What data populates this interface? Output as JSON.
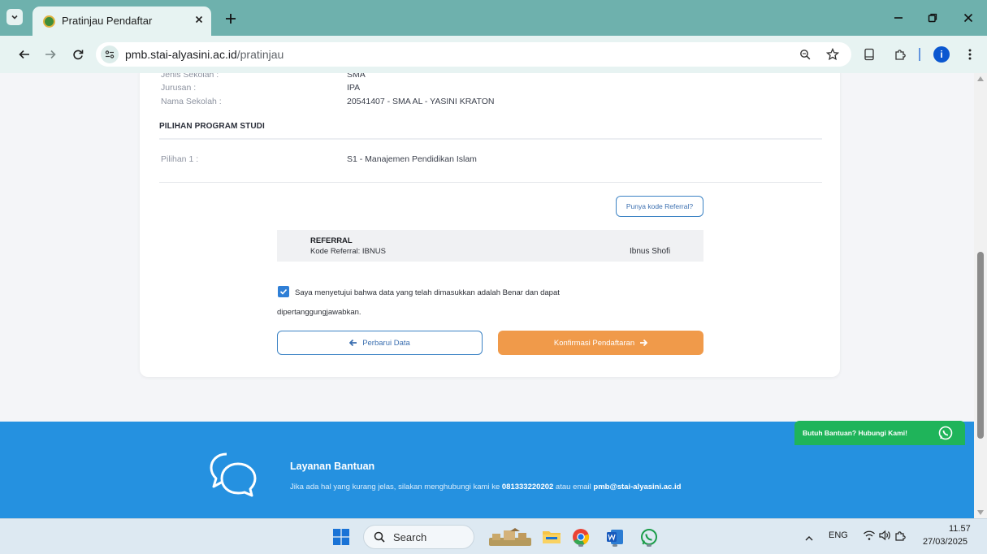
{
  "browser": {
    "tab_title": "Pratinjau Pendaftar",
    "url_host": "pmb.stai-alyasini.ac.id",
    "url_path": "/pratinjau",
    "accent_color": "#6eb1ad",
    "profile_initial": "i"
  },
  "page": {
    "school": {
      "rows": [
        {
          "label": "Jenis Sekolah :",
          "value": "SMA"
        },
        {
          "label": "Jurusan :",
          "value": "IPA"
        },
        {
          "label": "Nama Sekolah :",
          "value": "20541407 - SMA AL - YASINI KRATON"
        }
      ]
    },
    "program": {
      "section_title": "PILIHAN PROGRAM STUDI",
      "rows": [
        {
          "label": "Pilihan 1 :",
          "value": "S1 - Manajemen Pendidikan Islam"
        }
      ]
    },
    "referral": {
      "button_label": "Punya kode Referral?",
      "title": "REFERRAL",
      "code_line": "Kode Referral: IBNUS",
      "name": "Ibnus Shofi"
    },
    "agreement": {
      "checked": true,
      "line1": "Saya menyetujui bahwa data yang telah dimasukkan adalah Benar dan dapat",
      "line2": "dipertanggungjawabkan."
    },
    "actions": {
      "update_label": "Perbarui Data",
      "confirm_label": "Konfirmasi Pendaftaran",
      "confirm_color": "#f09a4a",
      "outline_color": "#3b82c4"
    },
    "footer": {
      "title": "Layanan Bantuan",
      "text_prefix": "Jika ada hal yang kurang jelas, silakan menghubungi kami ke ",
      "phone": "081333220202",
      "text_middle": " atau email ",
      "email": "pmb@stai-alyasini.ac.id",
      "background": "#2591e0"
    },
    "whatsapp": {
      "label": "Butuh Bantuan? Hubungi Kami!",
      "color": "#1fb45a"
    }
  },
  "taskbar": {
    "search_label": "Search",
    "language": "ENG",
    "time": "11.57",
    "date": "27/03/2025"
  }
}
